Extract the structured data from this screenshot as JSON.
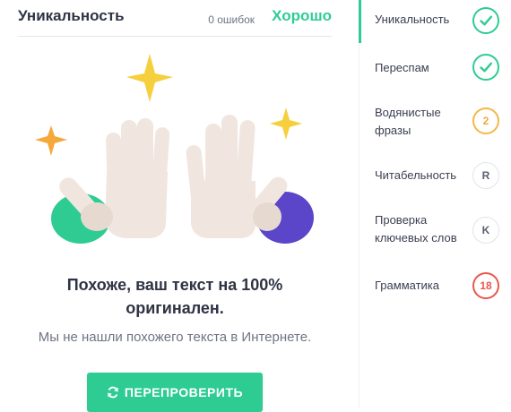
{
  "main": {
    "title": "Уникальность",
    "errors_text": "0 ошибок",
    "status": "Хорошо",
    "result_title_line1": "Похоже, ваш текст на 100%",
    "result_title_line2": "оригинален.",
    "result_subtitle": "Мы не нашли похожего текста в Интернете.",
    "recheck_button_label": "ПЕРЕПРОВЕРИТЬ",
    "recheck_icon": "refresh-icon"
  },
  "sidebar": {
    "items": [
      {
        "label_line1": "Уникальность",
        "label_line2": "",
        "badge_type": "check",
        "badge_text": "",
        "active": true
      },
      {
        "label_line1": "Переспам",
        "label_line2": "",
        "badge_type": "check",
        "badge_text": "",
        "active": false
      },
      {
        "label_line1": "Водянистые",
        "label_line2": "фразы",
        "badge_type": "warn",
        "badge_text": "2",
        "active": false
      },
      {
        "label_line1": "Читабельность",
        "label_line2": "",
        "badge_type": "neutral",
        "badge_text": "R",
        "active": false
      },
      {
        "label_line1": "Проверка",
        "label_line2": "ключевых слов",
        "badge_type": "neutral",
        "badge_text": "K",
        "active": false
      },
      {
        "label_line1": "Грамматика",
        "label_line2": "",
        "badge_type": "danger",
        "badge_text": "18",
        "active": false
      }
    ]
  },
  "colors": {
    "accent_green": "#2ecc93",
    "warn_orange": "#f5b84a",
    "danger_red": "#e9574d",
    "purple_sleeve": "#5b45c8",
    "star_yellow": "#f6cf3d",
    "hand_beige": "#f0e6df"
  }
}
